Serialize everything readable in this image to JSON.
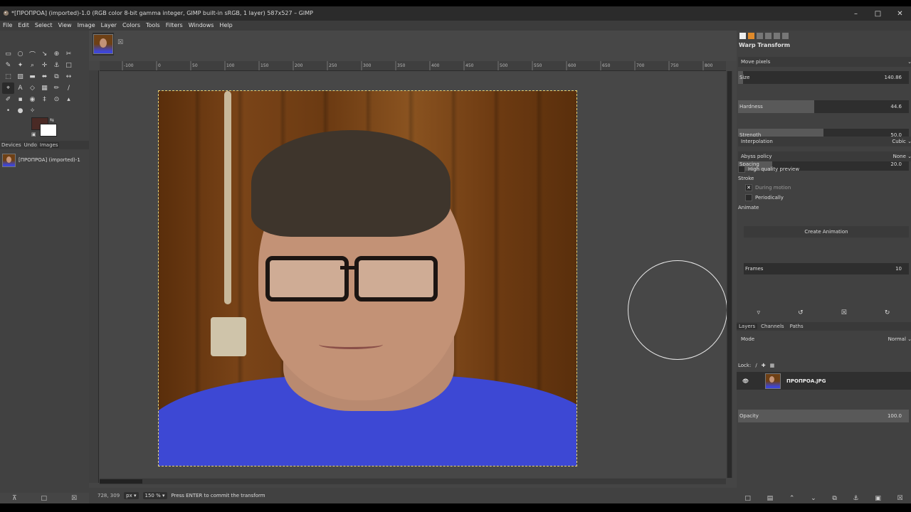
{
  "window": {
    "title": "*[ПРОПРОА] (imported)-1.0 (RGB color 8-bit gamma integer, GIMP built-in sRGB, 1 layer) 587x527 – GIMP",
    "minimize": "–",
    "maximize": "□",
    "close": "✕"
  },
  "menu": [
    "File",
    "Edit",
    "Select",
    "View",
    "Image",
    "Layer",
    "Colors",
    "Tools",
    "Filters",
    "Windows",
    "Help"
  ],
  "toolbox": {
    "tools": [
      [
        "▭",
        "○",
        "⌒",
        "↘",
        "⊕",
        "✂"
      ],
      [
        "✎",
        "✦",
        "⌕",
        "✛",
        "⚓",
        "□"
      ],
      [
        "⬚",
        "▧",
        "▬",
        "⬌",
        "⧉",
        "↔"
      ],
      [
        "⌖",
        "A",
        "◇",
        "▦",
        "✏",
        "∕"
      ],
      [
        "✐",
        "▪",
        "◉",
        "‡",
        "⊙",
        "▴"
      ],
      [
        "•",
        "●",
        "✧"
      ]
    ],
    "dock_tabs": [
      "Devices",
      "Undo",
      "Images"
    ],
    "image_item": "[ПРОПРОА] (imported)-1"
  },
  "colors": {
    "fg": "#4a2a25",
    "bg": "#ffffff"
  },
  "canvas": {
    "image_size": "587x527",
    "ruler_labels": [
      "-100",
      "0",
      "50",
      "100",
      "150",
      "200",
      "250",
      "300",
      "350",
      "400",
      "450",
      "500",
      "550",
      "600",
      "650",
      "700",
      "750",
      "800"
    ]
  },
  "status": {
    "coords": "728, 309",
    "unit": "px",
    "zoom": "150 %",
    "message": "Press ENTER to commit the transform"
  },
  "tool_options": {
    "title": "Warp Transform",
    "mode": "Move pixels",
    "size_label": "Size",
    "size_value": "140.86",
    "size_frac": 0.03,
    "hardness_label": "Hardness",
    "hardness_value": "44.6",
    "hardness_frac": 0.446,
    "strength_label": "Strength",
    "strength_value": "50.0",
    "strength_frac": 0.5,
    "spacing_label": "Spacing",
    "spacing_value": "20.0",
    "spacing_frac": 0.2,
    "interpolation_label": "Interpolation",
    "interpolation_value": "Cubic",
    "abyss_label": "Abyss policy",
    "abyss_value": "None",
    "hq_preview": "High quality preview",
    "stroke_label": "Stroke",
    "during_motion": "During motion",
    "periodically": "Periodically",
    "animate_label": "Animate",
    "frames_label": "Frames",
    "frames_value": "10",
    "create_animation": "Create Animation"
  },
  "layers": {
    "tabs": [
      "Layers",
      "Channels",
      "Paths"
    ],
    "mode_label": "Mode",
    "mode_value": "Normal",
    "opacity_label": "Opacity",
    "opacity_value": "100.0",
    "lock_label": "Lock:",
    "layer_name": "ПРОПРОА.JPG"
  }
}
